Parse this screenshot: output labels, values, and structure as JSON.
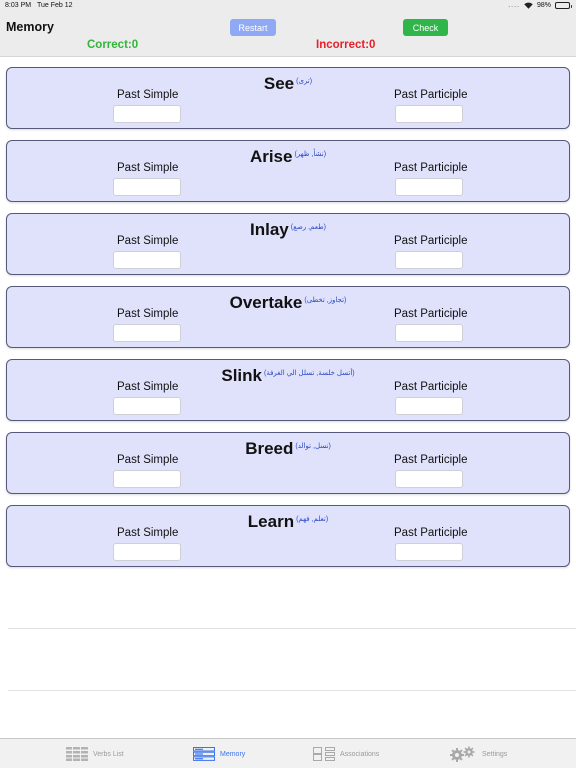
{
  "status_bar": {
    "time": "8:03 PM",
    "date": "Tue Feb 12",
    "signal": "....",
    "battery": "98%"
  },
  "header": {
    "title": "Memory",
    "restart_label": "Restart",
    "check_label": "Check",
    "correct_text": "Correct:0",
    "incorrect_text": "Incorrect:0"
  },
  "labels": {
    "past_simple": "Past Simple",
    "past_participle": "Past Participle"
  },
  "verbs": [
    {
      "verb": "See",
      "translation": "(ترى)",
      "past_simple": "",
      "past_participle": ""
    },
    {
      "verb": "Arise",
      "translation": "(نشأ, ظهر)",
      "past_simple": "",
      "past_participle": ""
    },
    {
      "verb": "Inlay",
      "translation": "(طعم, رصع)",
      "past_simple": "",
      "past_participle": ""
    },
    {
      "verb": "Overtake",
      "translation": "(تجاوز, تخطى)",
      "past_simple": "",
      "past_participle": ""
    },
    {
      "verb": "Slink",
      "translation": "(أتسل خلسة, تسلل الي الغرفة)",
      "past_simple": "",
      "past_participle": ""
    },
    {
      "verb": "Breed",
      "translation": "(نسل, توالد)",
      "past_simple": "",
      "past_participle": ""
    },
    {
      "verb": "Learn",
      "translation": "(تعلم, فهم)",
      "past_simple": "",
      "past_participle": ""
    }
  ],
  "tabs": [
    {
      "label": "Verbs List",
      "icon": "list-icon",
      "active": false
    },
    {
      "label": "Memory",
      "icon": "memory-icon",
      "active": true
    },
    {
      "label": "Associations",
      "icon": "associations-icon",
      "active": false
    },
    {
      "label": "Settings",
      "icon": "gear-icon",
      "active": false
    }
  ],
  "colors": {
    "accent": "#3b74f0",
    "restart_button": "#8fa9f5",
    "check_button": "#2fb54a",
    "correct": "#31b53a",
    "incorrect": "#e5222b",
    "card_bg": "#e0e2fb",
    "translation": "#2947c9"
  }
}
